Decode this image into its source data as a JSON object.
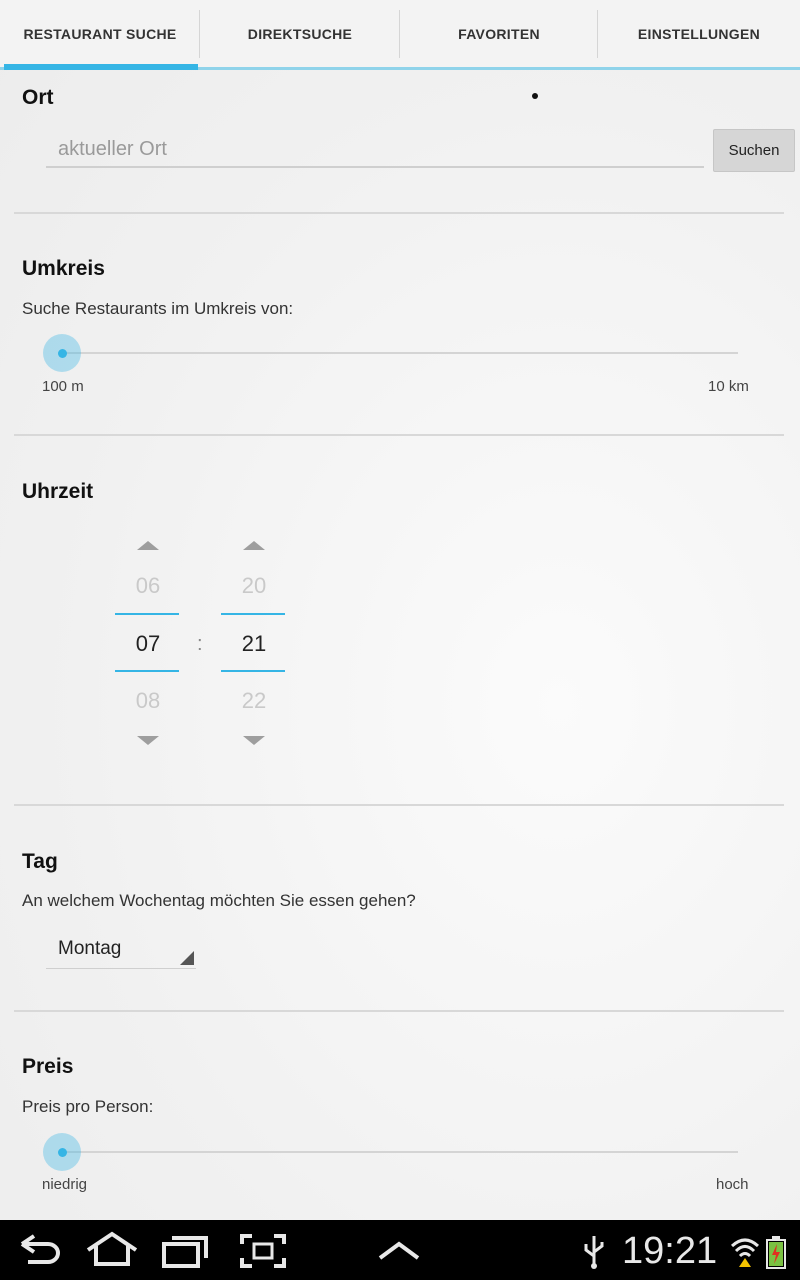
{
  "tabs": [
    {
      "label": "RESTAURANT SUCHE",
      "active": true
    },
    {
      "label": "DIREKTSUCHE",
      "active": false
    },
    {
      "label": "FAVORITEN",
      "active": false
    },
    {
      "label": "EINSTELLUNGEN",
      "active": false
    }
  ],
  "ort": {
    "title": "Ort",
    "placeholder": "aktueller Ort",
    "value": "",
    "search_button": "Suchen"
  },
  "umkreis": {
    "title": "Umkreis",
    "description": "Suche Restaurants im Umkreis von:",
    "min_label": "100 m",
    "max_label": "10 km",
    "slider_value": 0
  },
  "uhrzeit": {
    "title": "Uhrzeit",
    "hours": {
      "prev": "06",
      "current": "07",
      "next": "08"
    },
    "minutes": {
      "prev": "20",
      "current": "21",
      "next": "22"
    },
    "separator": ":"
  },
  "tag": {
    "title": "Tag",
    "description": "An welchem Wochentag möchten Sie essen gehen?",
    "selected": "Montag"
  },
  "preis": {
    "title": "Preis",
    "description": "Preis pro Person:",
    "min_label": "niedrig",
    "max_label": "hoch",
    "slider_value": 0
  },
  "status_bar": {
    "time": "19:21"
  },
  "colors": {
    "accent": "#35b5e5",
    "navbar": "#000000"
  }
}
